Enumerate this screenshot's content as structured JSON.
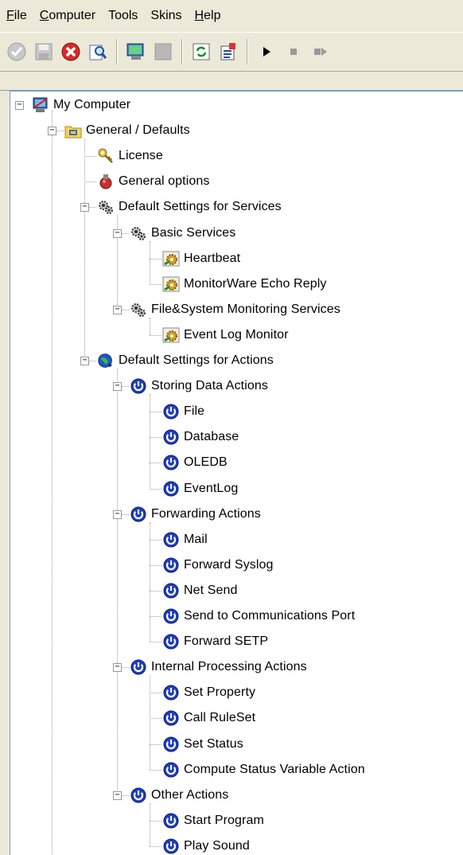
{
  "menu": [
    {
      "key": "file",
      "pre": "",
      "acc": "F",
      "post": "ile"
    },
    {
      "key": "computer",
      "pre": "",
      "acc": "C",
      "post": "omputer"
    },
    {
      "key": "tools",
      "pre": "Tools",
      "acc": "",
      "post": ""
    },
    {
      "key": "skins",
      "pre": "Skins",
      "acc": "",
      "post": ""
    },
    {
      "key": "help",
      "pre": "",
      "acc": "H",
      "post": "elp"
    }
  ],
  "toolbar": [
    {
      "name": "ok-icon",
      "kind": "ok"
    },
    {
      "name": "save-icon",
      "kind": "save"
    },
    {
      "name": "delete-icon",
      "kind": "cancel"
    },
    {
      "name": "find-icon",
      "kind": "find"
    },
    {
      "sep": true
    },
    {
      "name": "computer-icon",
      "kind": "computer"
    },
    {
      "name": "blank-icon",
      "kind": "blank"
    },
    {
      "sep": true
    },
    {
      "name": "refresh-icon",
      "kind": "refresh"
    },
    {
      "name": "wizard-icon",
      "kind": "wizard"
    },
    {
      "sep": true
    },
    {
      "name": "play-icon",
      "kind": "play"
    },
    {
      "name": "stop-icon",
      "kind": "stop"
    },
    {
      "name": "step-icon",
      "kind": "step"
    }
  ],
  "tree": [
    {
      "label": "My Computer",
      "icon": "computer",
      "level": 0,
      "expanded": true
    },
    {
      "label": "General / Defaults",
      "icon": "folder",
      "level": 1,
      "expanded": true
    },
    {
      "label": "License",
      "icon": "key",
      "level": 2
    },
    {
      "label": "General options",
      "icon": "options",
      "level": 2
    },
    {
      "label": "Default Settings for Services",
      "icon": "gears",
      "level": 2,
      "expanded": true
    },
    {
      "label": "Basic Services",
      "icon": "gears",
      "level": 3,
      "expanded": true
    },
    {
      "label": "Heartbeat",
      "icon": "service",
      "level": 4
    },
    {
      "label": "MonitorWare Echo Reply",
      "icon": "service",
      "level": 4
    },
    {
      "label": "File&System Monitoring Services",
      "icon": "gears",
      "level": 3,
      "expanded": true
    },
    {
      "label": "Event Log Monitor",
      "icon": "service",
      "level": 4
    },
    {
      "label": "Default Settings for Actions",
      "icon": "globe",
      "level": 2,
      "expanded": true
    },
    {
      "label": "Storing Data Actions",
      "icon": "power",
      "level": 3,
      "expanded": true
    },
    {
      "label": "File",
      "icon": "power",
      "level": 4
    },
    {
      "label": "Database",
      "icon": "power",
      "level": 4
    },
    {
      "label": "OLEDB",
      "icon": "power",
      "level": 4
    },
    {
      "label": "EventLog",
      "icon": "power",
      "level": 4
    },
    {
      "label": "Forwarding Actions",
      "icon": "power",
      "level": 3,
      "expanded": true
    },
    {
      "label": "Mail",
      "icon": "power",
      "level": 4
    },
    {
      "label": "Forward Syslog",
      "icon": "power",
      "level": 4
    },
    {
      "label": "Net Send",
      "icon": "power",
      "level": 4
    },
    {
      "label": "Send to Communications Port",
      "icon": "power",
      "level": 4
    },
    {
      "label": "Forward SETP",
      "icon": "power",
      "level": 4
    },
    {
      "label": "Internal Processing Actions",
      "icon": "power",
      "level": 3,
      "expanded": true
    },
    {
      "label": "Set Property",
      "icon": "power",
      "level": 4
    },
    {
      "label": "Call RuleSet",
      "icon": "power",
      "level": 4
    },
    {
      "label": "Set Status",
      "icon": "power",
      "level": 4
    },
    {
      "label": "Compute Status Variable Action",
      "icon": "power",
      "level": 4
    },
    {
      "label": "Other Actions",
      "icon": "power",
      "level": 3,
      "expanded": true
    },
    {
      "label": "Start Program",
      "icon": "power",
      "level": 4
    },
    {
      "label": "Play Sound",
      "icon": "power",
      "level": 4
    }
  ]
}
